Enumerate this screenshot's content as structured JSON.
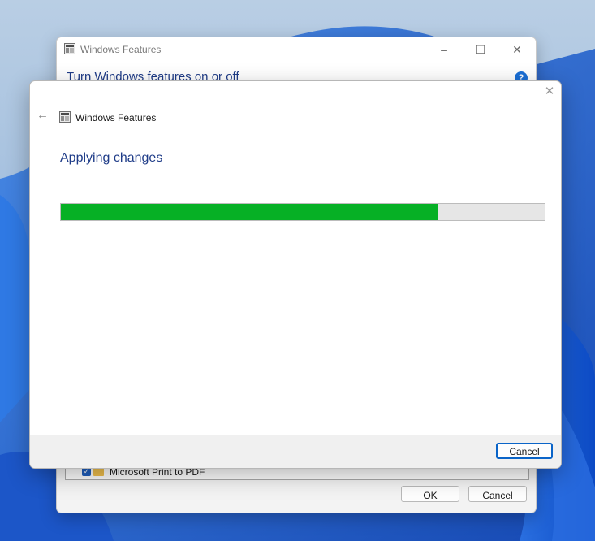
{
  "background_window": {
    "title": "Windows Features",
    "heading": "Turn Windows features on or off",
    "help_icon": "question-icon",
    "feature_item": {
      "checked": true,
      "label": "Microsoft Print to PDF"
    },
    "ok_label": "OK",
    "cancel_label": "Cancel"
  },
  "dialog": {
    "title": "Windows Features",
    "status_text": "Applying changes",
    "progress_fraction": 0.78,
    "cancel_label": "Cancel"
  },
  "colors": {
    "progress_fill": "#06b025",
    "heading_blue": "#1f3c88",
    "help_blue": "#1a6fd6"
  }
}
